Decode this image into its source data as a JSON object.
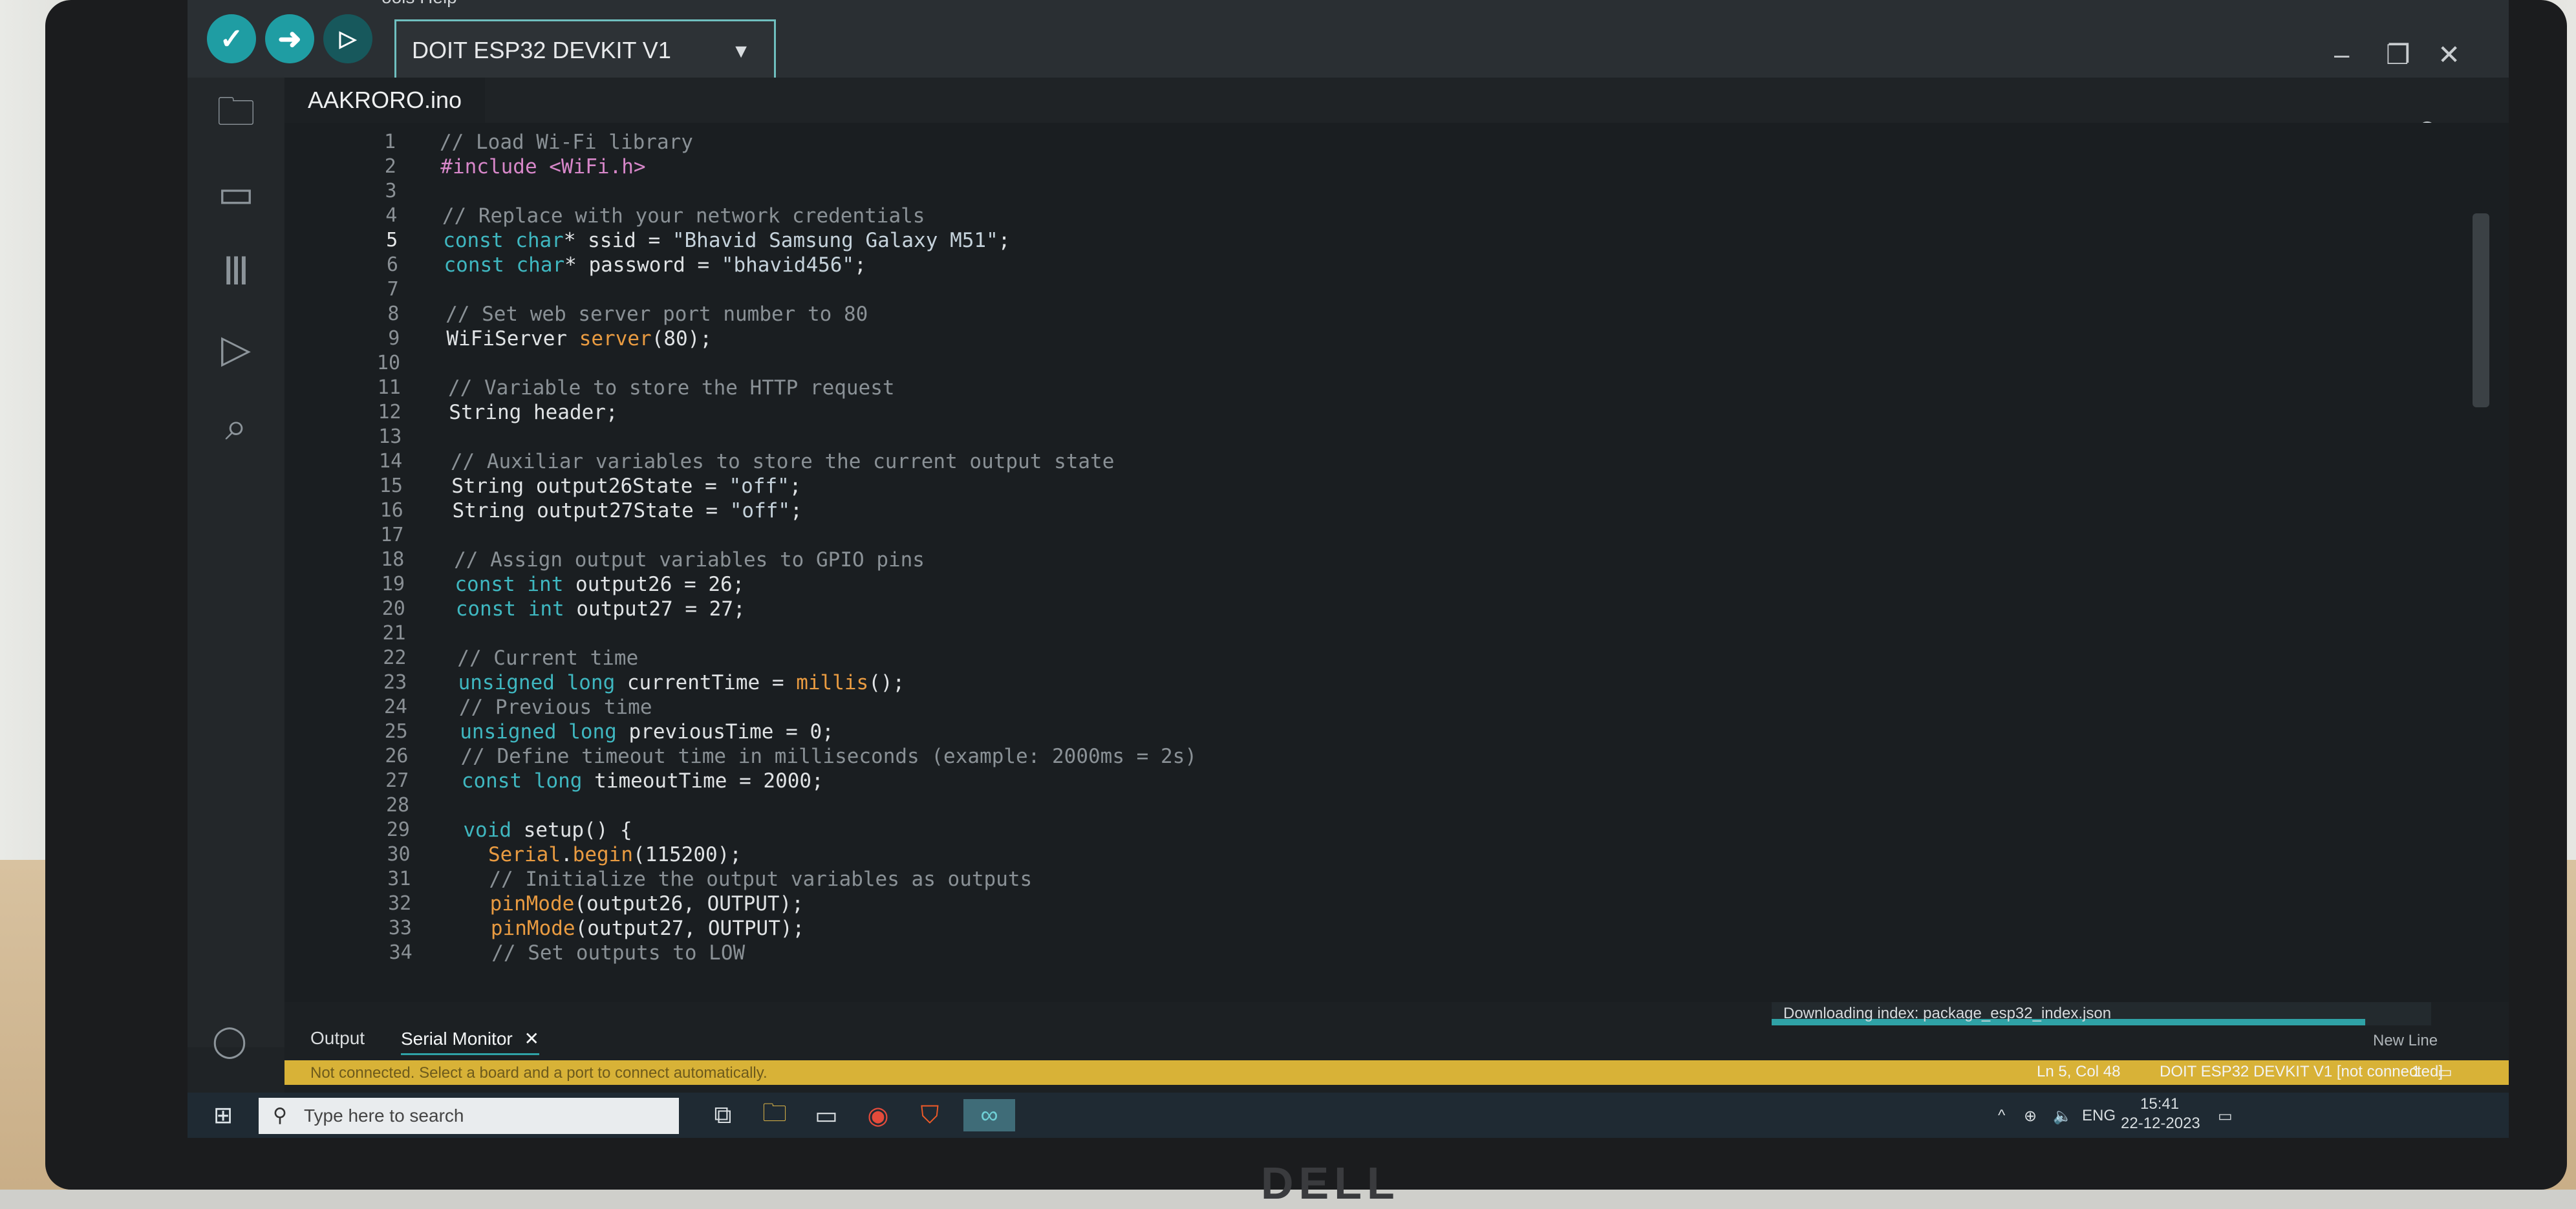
{
  "app": {
    "menu_partial": "ools   Help",
    "board": "DOIT ESP32 DEVKIT V1",
    "tab_name": "AAKRORO.ino"
  },
  "editor": {
    "lines": [
      {
        "n": "1",
        "t": "// Load Wi-Fi library"
      },
      {
        "n": "2",
        "t": "#include <WiFi.h>"
      },
      {
        "n": "3",
        "t": ""
      },
      {
        "n": "4",
        "t": "// Replace with your network credentials"
      },
      {
        "n": "5",
        "t": "const char* ssid = \"Bhavid Samsung Galaxy M51\";"
      },
      {
        "n": "6",
        "t": "const char* password = \"bhavid456\";"
      },
      {
        "n": "7",
        "t": ""
      },
      {
        "n": "8",
        "t": "// Set web server port number to 80"
      },
      {
        "n": "9",
        "t": "WiFiServer server(80);"
      },
      {
        "n": "10",
        "t": ""
      },
      {
        "n": "11",
        "t": "// Variable to store the HTTP request"
      },
      {
        "n": "12",
        "t": "String header;"
      },
      {
        "n": "13",
        "t": ""
      },
      {
        "n": "14",
        "t": "// Auxiliar variables to store the current output state"
      },
      {
        "n": "15",
        "t": "String output26State = \"off\";"
      },
      {
        "n": "16",
        "t": "String output27State = \"off\";"
      },
      {
        "n": "17",
        "t": ""
      },
      {
        "n": "18",
        "t": "// Assign output variables to GPIO pins"
      },
      {
        "n": "19",
        "t": "const int output26 = 26;"
      },
      {
        "n": "20",
        "t": "const int output27 = 27;"
      },
      {
        "n": "21",
        "t": ""
      },
      {
        "n": "22",
        "t": "// Current time"
      },
      {
        "n": "23",
        "t": "unsigned long currentTime = millis();"
      },
      {
        "n": "24",
        "t": "// Previous time"
      },
      {
        "n": "25",
        "t": "unsigned long previousTime = 0;"
      },
      {
        "n": "26",
        "t": "// Define timeout time in milliseconds (example: 2000ms = 2s)"
      },
      {
        "n": "27",
        "t": "const long timeoutTime = 2000;"
      },
      {
        "n": "28",
        "t": ""
      },
      {
        "n": "29",
        "t": "void setup() {"
      },
      {
        "n": "30",
        "t": "  Serial.begin(115200);"
      },
      {
        "n": "31",
        "t": "  // Initialize the output variables as outputs"
      },
      {
        "n": "32",
        "t": "  pinMode(output26, OUTPUT);"
      },
      {
        "n": "33",
        "t": "  pinMode(output27, OUTPUT);"
      },
      {
        "n": "34",
        "t": "  // Set outputs to LOW"
      }
    ]
  },
  "panel": {
    "tab_output": "Output",
    "tab_serial": "Serial Monitor",
    "tab_close": "✕",
    "progress_text": "Downloading index: package_esp32_index.json",
    "progress": 0.9,
    "status_warning": "Not connected. Select a board and a port to connect automatically.",
    "newline_label": "New Line",
    "cursor_pos": "Ln 5, Col 48",
    "board_status": "DOIT ESP32 DEVKIT V1 [not connected]",
    "notifications": "1"
  },
  "taskbar": {
    "search_placeholder": "Type here to search",
    "lang": "ENG",
    "time": "15:41",
    "date": "22-12-2023"
  },
  "colors": {
    "accent": "#2fa2a6",
    "status_bar": "#d8b237",
    "verify": "#1f9da3"
  }
}
